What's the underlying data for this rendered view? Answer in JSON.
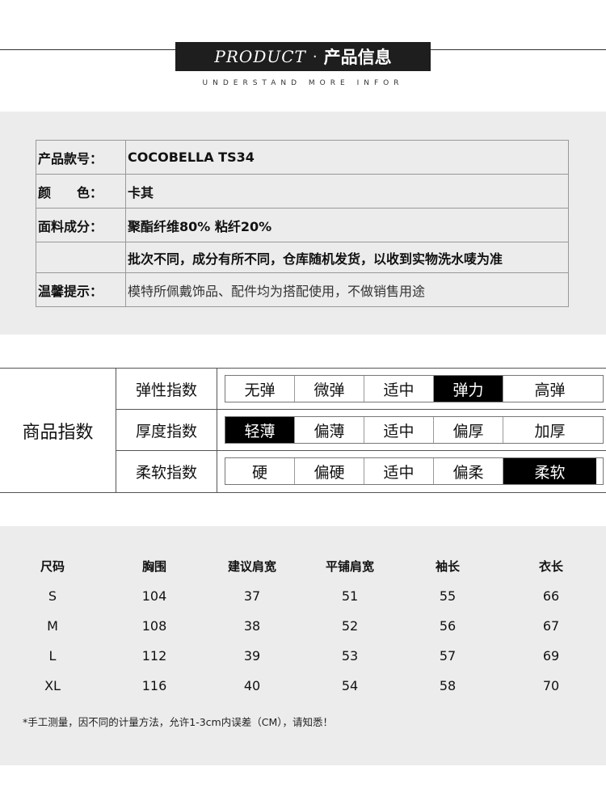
{
  "header": {
    "title_en": "PRODUCT",
    "separator": "·",
    "title_cn": "产品信息",
    "subtitle": "UNDERSTAND MORE INFOR"
  },
  "info": {
    "rows": [
      {
        "label": "产品款号：",
        "value": "COCOBELLA TS34"
      },
      {
        "label": "颜　　色：",
        "value": "卡其"
      },
      {
        "label": "面料成分：",
        "value": "聚酯纤维80% 粘纤20%"
      },
      {
        "label": "",
        "value": "批次不同，成分有所不同，仓库随机发货，以收到实物洗水唛为准"
      },
      {
        "label": "温馨提示：",
        "value": "模特所佩戴饰品、配件均为搭配使用，不做销售用途"
      }
    ]
  },
  "index": {
    "title": "商品指数",
    "rows": [
      {
        "label": "弹性指数",
        "options": [
          "无弹",
          "微弹",
          "适中",
          "弹力",
          "高弹"
        ],
        "selected": "弹力"
      },
      {
        "label": "厚度指数",
        "options": [
          "轻薄",
          "偏薄",
          "适中",
          "偏厚",
          "加厚"
        ],
        "selected": "轻薄"
      },
      {
        "label": "柔软指数",
        "options": [
          "硬",
          "偏硬",
          "适中",
          "偏柔",
          "柔软"
        ],
        "selected": "柔软"
      }
    ]
  },
  "sizes": {
    "headers": [
      "尺码",
      "胸围",
      "建议肩宽",
      "平铺肩宽",
      "袖长",
      "衣长"
    ],
    "rows": [
      [
        "S",
        "104",
        "37",
        "51",
        "55",
        "66"
      ],
      [
        "M",
        "108",
        "38",
        "52",
        "56",
        "67"
      ],
      [
        "L",
        "112",
        "39",
        "53",
        "57",
        "69"
      ],
      [
        "XL",
        "116",
        "40",
        "54",
        "58",
        "70"
      ]
    ],
    "note": "*手工测量，因不同的计量方法，允许1-3cm内误差（CM），请知悉！"
  },
  "colors": {
    "header_bg": "#1e1e1e",
    "section_bg": "#ececec",
    "selected_bg": "#000000"
  }
}
